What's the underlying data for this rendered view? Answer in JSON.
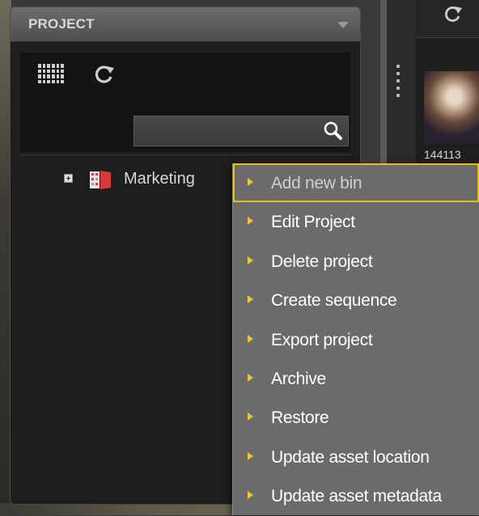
{
  "project_panel": {
    "title": "PROJECT",
    "search": {
      "value": "",
      "placeholder": ""
    },
    "tree": [
      {
        "label": "Marketing",
        "icon": "project-icon"
      }
    ]
  },
  "right_panel": {
    "thumbnail_label": "144113"
  },
  "context_menu": {
    "items": [
      {
        "label": "Add new bin",
        "state": "highlighted"
      },
      {
        "label": "Edit Project"
      },
      {
        "label": "Delete project"
      },
      {
        "label": "Create sequence"
      },
      {
        "label": "Export project"
      },
      {
        "label": "Archive"
      },
      {
        "label": "Restore"
      },
      {
        "label": "Update asset location"
      },
      {
        "label": "Update asset metadata"
      }
    ]
  },
  "colors": {
    "menu_bg": "#6b6b6b",
    "highlight_border": "#e4c21c",
    "arrow": "#f0c33a",
    "panel_bg": "#1e1e1e"
  }
}
